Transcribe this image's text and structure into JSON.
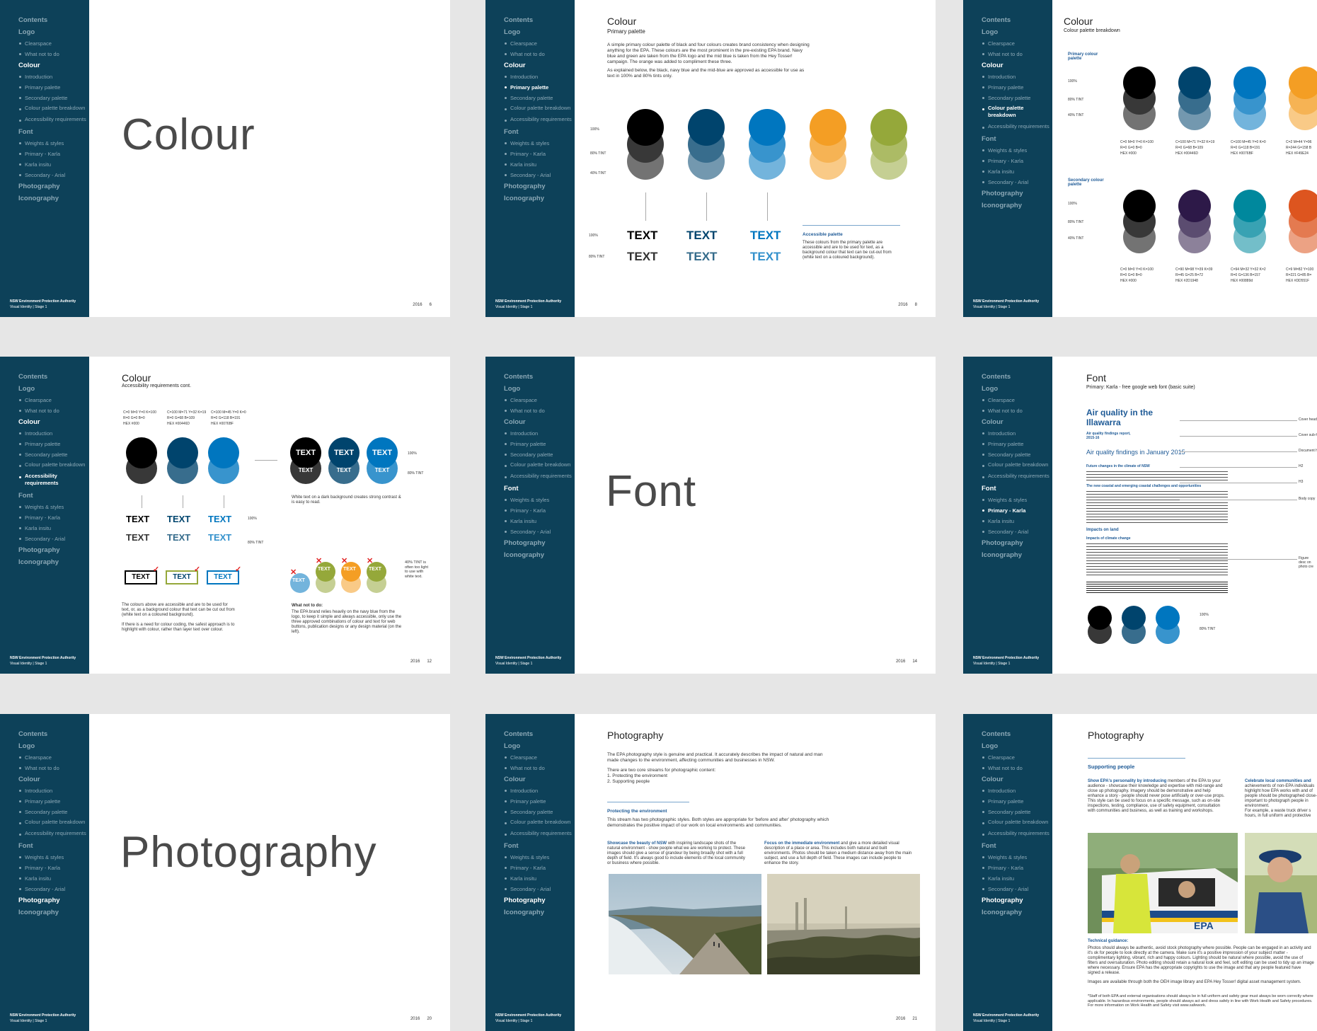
{
  "nav": {
    "contents": "Contents",
    "logo": "Logo",
    "clearspace": "Clearspace",
    "what_not": "What not to do",
    "colour": "Colour",
    "introduction": "Introduction",
    "primary_palette": "Primary palette",
    "secondary_palette": "Secondary palette",
    "palette_breakdown": "Colour palette breakdown",
    "accessibility": "Accessibility requirements",
    "font": "Font",
    "weights": "Weights & styles",
    "primary_karla": "Primary - Karla",
    "karla_insitu": "Karla insitu",
    "secondary_arial": "Secondary - Arial",
    "photography": "Photography",
    "iconography": "Iconography"
  },
  "footer": {
    "org": "NSW Environment Protection Authority",
    "doc": "Visual Identity | Stage 1",
    "year": "2016"
  },
  "pages": {
    "p1": {
      "big": "Colour",
      "num": "6"
    },
    "p2": {
      "title": "Colour",
      "subtitle": "Primary palette",
      "num": "8",
      "para1": "A simple primary colour palette of black and four colours creates brand consistency when designing anything for the EPA. These colours are the most prominent in the pre-existing EPA brand. Navy blue and green are taken from the EPA logo and the mid blue is taken from the Hey Tosser! campaign. The orange was added to compliment these three.",
      "para2": "As explained below, the black, navy blue and the mid-blue are approved as accessible for use as text in 100% and 80% tints only.",
      "t100": "100%",
      "t80": "80% TINT",
      "t40": "40% TINT",
      "text_word": "TEXT",
      "acc_head": "Accessible palette",
      "acc_body": "These colours from the primary palette are accessible and are to be used for text, as a background colour that text can be cut-out from (white text on a coloured background)."
    },
    "p3": {
      "title": "Colour",
      "subtitle": "Colour palette breakdown",
      "primary_head": "Primary colour palette",
      "secondary_head": "Secondary colour palette",
      "t100": "100%",
      "t80": "80% TINT",
      "t40": "40% TINT",
      "primary_specs": [
        [
          "C=0 M=0 Y=0 K=100",
          "R=0 G=0 B=0",
          "HEX #000"
        ],
        [
          "C=100 M=71 Y=32 K=19",
          "R=0 G=68 B=109",
          "HEX #00446D"
        ],
        [
          "C=100 M=45 Y=0 K=0",
          "R=0 G=118 B=191",
          "HEX #0076BF"
        ],
        [
          "C=2 M=44 Y=96",
          "R=244 G=158 B",
          "HEX #F49E24"
        ]
      ],
      "secondary_specs": [
        [
          "C=0 M=0 Y=0 K=100",
          "R=0 G=0 B=0",
          "HEX #000"
        ],
        [
          "C=90 M=98 Y=39 K=39",
          "R=45 G=25 B=72",
          "HEX #2D1948"
        ],
        [
          "C=94 M=32 Y=32 K=2",
          "R=0 G=136 B=157",
          "HEX #00889d"
        ],
        [
          "C=9 M=82 Y=100",
          "R=221 G=85 B=",
          "HEX #DD551F"
        ]
      ]
    },
    "p4": {
      "title": "Colour",
      "subtitle": "Accessibility requirements cont.",
      "num": "12",
      "specs": [
        [
          "C=0 M=0 Y=0 K=100",
          "R=0 G=0 B=0",
          "HEX #000"
        ],
        [
          "C=100 M=71 Y=32 K=19",
          "R=0 G=68 B=109",
          "HEX #00446D"
        ],
        [
          "C=100 M=45 Y=0 K=0",
          "R=0 G=118 B=191",
          "HEX #0076BF"
        ]
      ],
      "text_word": "TEXT",
      "t100": "100%",
      "t80": "80% TINT",
      "white_note": "White text on a dark background creates strong contrast & is easy to read.",
      "bottom_left": "The colours above are accessible and are to be used for text, or, as a background colour that text can be cut out from (white text on a coloured background).",
      "bottom_left2": "If there is a need for colour coding, the safest approach is to highlight with colour, rather than layer text over colour.",
      "what_not_head": "What not to do:",
      "what_not_body": "The EPA brand relies heavily on the navy blue from the logo, to keep it simple and always accessible, only use the three approved combinations of colour and text for web buttons, publication designs or any design material (on the left).",
      "light_note": "40% TINT is often too light to use with white text."
    },
    "p5": {
      "big": "Font",
      "num": "14"
    },
    "p6": {
      "title": "Font",
      "subtitle": "Primary: Karla - free google web font (basic suite)",
      "doc_title": "Air quality in the Illawarra",
      "doc_sub": "Air quality findings report, 2015-16",
      "doc_h1": "Air quality findings in January 2015",
      "doc_h2a": "Future changes in the climate of NSW",
      "doc_h2b": "The new coastal and emerging coastal challenges and opportunities",
      "doc_h2c": "Impacts on land",
      "doc_h3": "Impacts of climate change",
      "labels": [
        "Cover headi",
        "Cover sub-he",
        "Document he",
        "H2",
        "H3",
        "Body copy",
        "Figure desc on photo cre"
      ],
      "t100": "100%",
      "t80": "80% TINT"
    },
    "p7": {
      "big": "Photography",
      "num": "20"
    },
    "p8": {
      "title": "Photography",
      "num": "21",
      "para1": "The EPA photography style is genuine and practical. It accurately describes the impact of natural and man made changes to the environment, affecting communities and businesses in NSW.",
      "para2": "There are two core streams for photographic content:",
      "list1": "1. Protecting the environment",
      "list2": "2. Supporting people",
      "section": "Protecting the environment",
      "section_body": "This stream has two photographic styles. Both styles are appropriate for 'before and after' photography which demonstrates the positive impact of our work on local environments and communities.",
      "left_head": "Showcase the beauty of NSW",
      "left_body": "with inspiring landscape shots of the natural environment - show people what we are working to protect. These images should give a sense of grandeur by being broadly shot with a full depth of field. It's always good to include elements of the local community or business where possible.",
      "right_head": "Focus on the immediate environment",
      "right_body": "and give a more detailed visual description of a place or area. This includes both natural and built environments. Photos should be taken a medium distance away from the main subject, and use a full depth of field. These images can include people to enhance the story."
    },
    "p9": {
      "title": "Photography",
      "section": "Supporting people",
      "left_head": "Show EPA's personality by introducing",
      "left_body": "members of the EPA to your audience - showcase their knowledge and expertise with mid-range and close up photography. Imagery should be demonstrative and help enhance a story - people should never pose artificially or over-use props. This style can be used to focus on a specific message, such as on-site inspections, testing, compliance, use of safety equipment, consultation with communities and business, as well as training and workshops.",
      "right_head": "Celebrate local communities and",
      "right_body": "achievements of non-EPA individuals highlight how EPA works with and of people should be photographed close-up important to photograph people in environment.",
      "right_body2": "For example, a waste truck driver s hours, in full uniform and protective",
      "tech_head": "Technical guidance:",
      "tech_body": "Photos should always be authentic, avoid stock photography where possible. People can be engaged in an activity and it's ok for people to look directly at the camera. Make sure it's a positive impression of your subject matter - complimentary lighting, vibrant, rich and happy colours. Lighting should be natural where possible, avoid the use of filters and oversaturation. Photo editing should retain a natural look and feel, soft editing can be used to tidy up an image where necessary. Ensure EPA has the appropriate copyrights to use the image and that any people featured have signed a release.",
      "tech_body2": "Images are available through both the OEH image library and EPA Hey Tosser! digital asset management system.",
      "tech_body3": "*Staff of both EPA and external organisations should always be in full uniform and safety gear must always be worn correctly where applicable. In hazardous environments, people should always act and dress safely in line with Work Health and Safety procedures. For more information on Work Health and Safety visit www.safework."
    }
  },
  "colors": {
    "sidebar": "#0d4159",
    "black": "#000000",
    "navy": "#00446d",
    "blue": "#0076bf",
    "orange": "#f49e24",
    "green": "#95a83a",
    "purple": "#2d1948",
    "teal": "#00889d",
    "red": "#dd551f"
  }
}
